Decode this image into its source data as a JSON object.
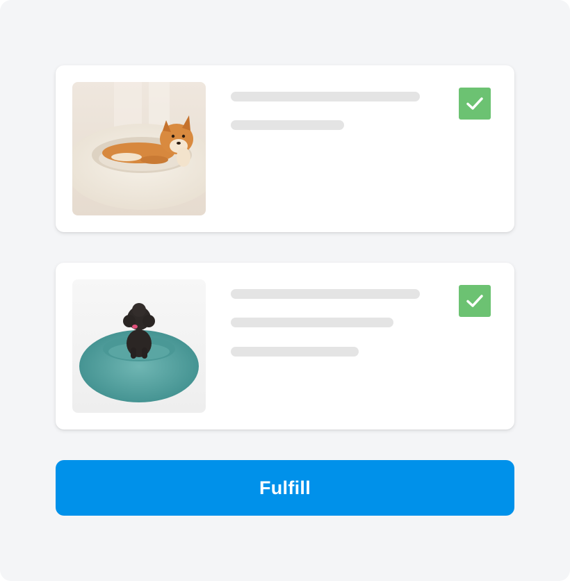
{
  "items": [
    {
      "image": "shiba-inu-on-cream-donut-bed",
      "selected": true,
      "check_icon": "checkmark-icon",
      "placeholder_lines": 2
    },
    {
      "image": "black-poodle-on-teal-donut-bed",
      "selected": true,
      "check_icon": "checkmark-icon",
      "placeholder_lines": 3
    }
  ],
  "fulfill_button": {
    "label": "Fulfill"
  },
  "colors": {
    "background": "#f4f5f7",
    "card": "#ffffff",
    "placeholder": "#e4e4e4",
    "check": "#6cc272",
    "primary": "#0091ea"
  }
}
